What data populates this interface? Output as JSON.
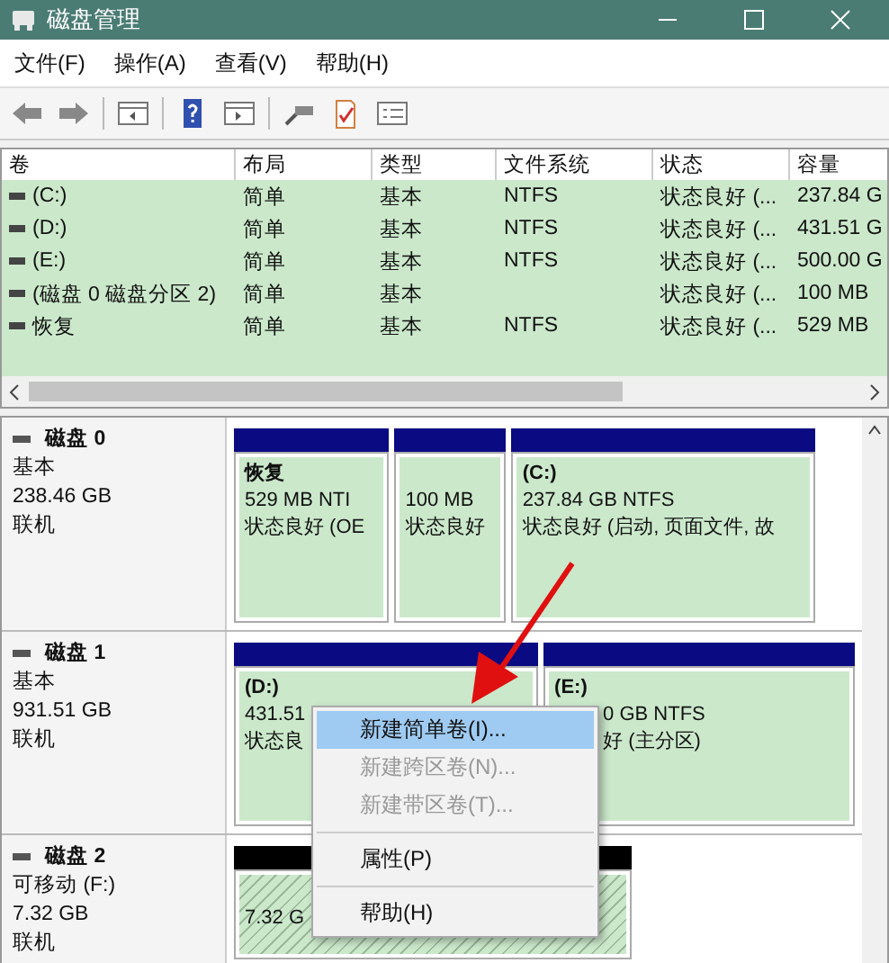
{
  "window": {
    "title": "磁盘管理"
  },
  "menu": [
    "文件(F)",
    "操作(A)",
    "查看(V)",
    "帮助(H)"
  ],
  "table": {
    "columns": [
      "卷",
      "布局",
      "类型",
      "文件系统",
      "状态",
      "容量"
    ],
    "rows": [
      [
        "(C:)",
        "简单",
        "基本",
        "NTFS",
        "状态良好 (...",
        "237.84 G"
      ],
      [
        "(D:)",
        "简单",
        "基本",
        "NTFS",
        "状态良好 (...",
        "431.51 G"
      ],
      [
        "(E:)",
        "简单",
        "基本",
        "NTFS",
        "状态良好 (...",
        "500.00 G"
      ],
      [
        "(磁盘 0 磁盘分区 2)",
        "简单",
        "基本",
        "",
        "状态良好 (...",
        "100 MB"
      ],
      [
        "恢复",
        "简单",
        "基本",
        "NTFS",
        "状态良好 (...",
        "529 MB"
      ]
    ]
  },
  "disks": [
    {
      "name": "磁盘 0",
      "lines": [
        "基本",
        "238.46 GB",
        "联机"
      ],
      "partitions": [
        {
          "kind": "primary",
          "title": "恢复",
          "lines": [
            "529 MB NTI",
            "状态良好 (OE"
          ]
        },
        {
          "kind": "primary",
          "lines": [
            "100 MB",
            "状态良好"
          ]
        },
        {
          "kind": "primary",
          "title": "(C:)",
          "lines": [
            "237.84 GB NTFS",
            "状态良好 (启动, 页面文件, 故"
          ]
        }
      ]
    },
    {
      "name": "磁盘 1",
      "lines": [
        "基本",
        "931.51 GB",
        "联机"
      ],
      "partitions": [
        {
          "kind": "primary",
          "title": "(D:)",
          "lines": [
            "431.51",
            "状态良"
          ]
        },
        {
          "kind": "primary",
          "title": "(E:)",
          "lines": [
            "0 GB NTFS",
            "好 (主分区)"
          ]
        }
      ]
    },
    {
      "name": "磁盘 2",
      "lines": [
        "可移动 (F:)",
        "7.32 GB",
        "联机"
      ],
      "partitions": [
        {
          "kind": "unallocated",
          "lines": [
            "7.32 G"
          ]
        }
      ]
    }
  ],
  "context_menu": [
    {
      "kind": "item",
      "label": "新建简单卷(I)...",
      "selected": true,
      "disabled": false
    },
    {
      "kind": "item",
      "label": "新建跨区卷(N)...",
      "selected": false,
      "disabled": true
    },
    {
      "kind": "item",
      "label": "新建带区卷(T)...",
      "selected": false,
      "disabled": true
    },
    {
      "kind": "separator"
    },
    {
      "kind": "item",
      "label": "属性(P)",
      "selected": false,
      "disabled": false
    },
    {
      "kind": "separator"
    },
    {
      "kind": "item",
      "label": "帮助(H)",
      "selected": false,
      "disabled": false
    }
  ]
}
